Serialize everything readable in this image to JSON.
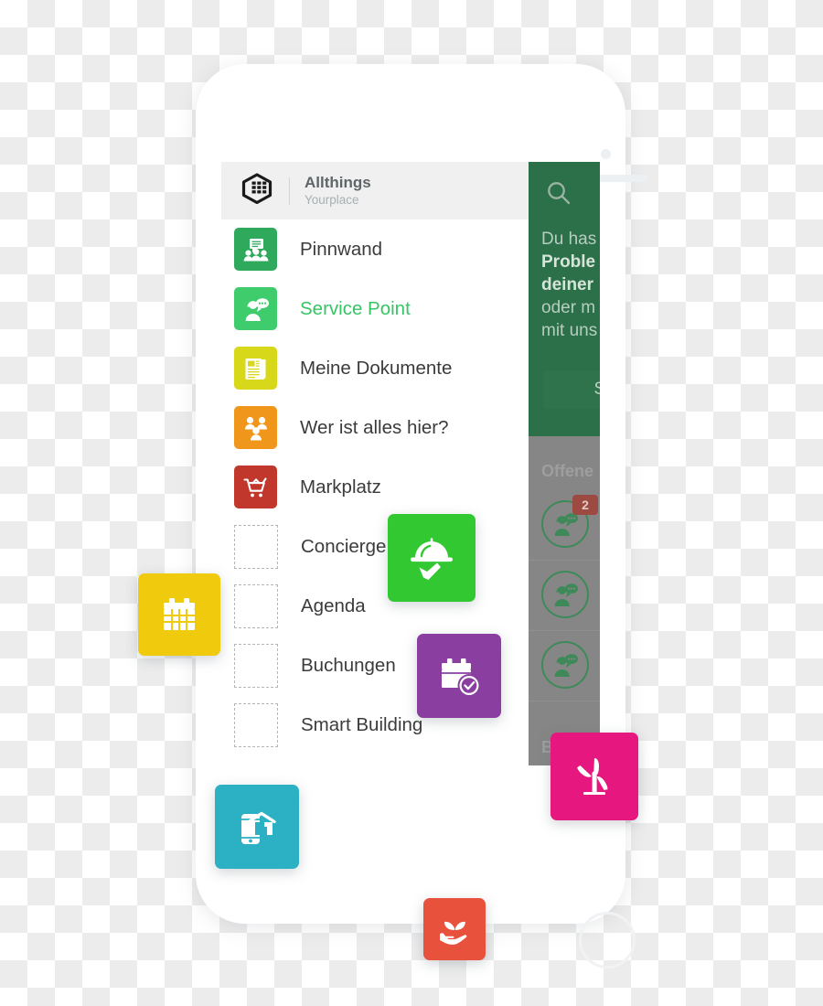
{
  "app": {
    "brand_name": "Allthings",
    "brand_subtitle": "Yourplace",
    "logo_icon": "allthings-hexagon-logo"
  },
  "menu": {
    "items": [
      {
        "label": "Pinnwand",
        "icon": "pinboard-icon",
        "tile_color": "#2faa5d",
        "active": false,
        "placeholder": false
      },
      {
        "label": "Service Point",
        "icon": "service-point-icon",
        "tile_color": "#3ecc6d",
        "active": true,
        "placeholder": false
      },
      {
        "label": "Meine Dokumente",
        "icon": "documents-icon",
        "tile_color": "#d8d81b",
        "active": false,
        "placeholder": false
      },
      {
        "label": "Wer ist alles hier?",
        "icon": "people-icon",
        "tile_color": "#f0971b",
        "active": false,
        "placeholder": false
      },
      {
        "label": "Markplatz",
        "icon": "shopping-cart-icon",
        "tile_color": "#c1372c",
        "active": false,
        "placeholder": false
      },
      {
        "label": "Concierge",
        "icon": "empty-slot-icon",
        "tile_color": "",
        "active": false,
        "placeholder": true
      },
      {
        "label": "Agenda",
        "icon": "empty-slot-icon",
        "tile_color": "",
        "active": false,
        "placeholder": true
      },
      {
        "label": "Buchungen",
        "icon": "empty-slot-icon",
        "tile_color": "",
        "active": false,
        "placeholder": true
      },
      {
        "label": "Smart Building",
        "icon": "empty-slot-icon",
        "tile_color": "",
        "active": false,
        "placeholder": true
      }
    ]
  },
  "right_panel": {
    "search_icon": "search-icon",
    "promo_line1": "Du has",
    "promo_line2_bold": "Proble",
    "promo_line3_bold": "deiner",
    "promo_line4": "oder m",
    "promo_line5": "mit uns",
    "button_label": "Schr",
    "list_title": "Offene",
    "bottom_label": "B",
    "items": [
      {
        "avatar_icon": "service-point-avatar-icon",
        "badge": "2"
      },
      {
        "avatar_icon": "service-point-avatar-icon",
        "badge": ""
      },
      {
        "avatar_icon": "service-point-avatar-icon",
        "badge": ""
      }
    ]
  },
  "floating_tiles": [
    {
      "name": "agenda-tile",
      "icon": "calendar-icon",
      "color": "#f0ca0c"
    },
    {
      "name": "concierge-tile",
      "icon": "room-service-icon",
      "color": "#32c832"
    },
    {
      "name": "buchungen-tile",
      "icon": "calendar-check-icon",
      "color": "#8a3fa0"
    },
    {
      "name": "smart-building-tile",
      "icon": "smart-home-phone-icon",
      "color": "#2cb1c4"
    },
    {
      "name": "energy-tile",
      "icon": "wind-turbine-icon",
      "color": "#e6187f"
    },
    {
      "name": "green-tile",
      "icon": "hand-plant-icon",
      "color": "#e8513c"
    }
  ],
  "colors": {
    "accent_green": "#36c464",
    "panel_green": "#2c7049",
    "panel_grey": "#868686",
    "badge_red": "#9c4a42"
  }
}
